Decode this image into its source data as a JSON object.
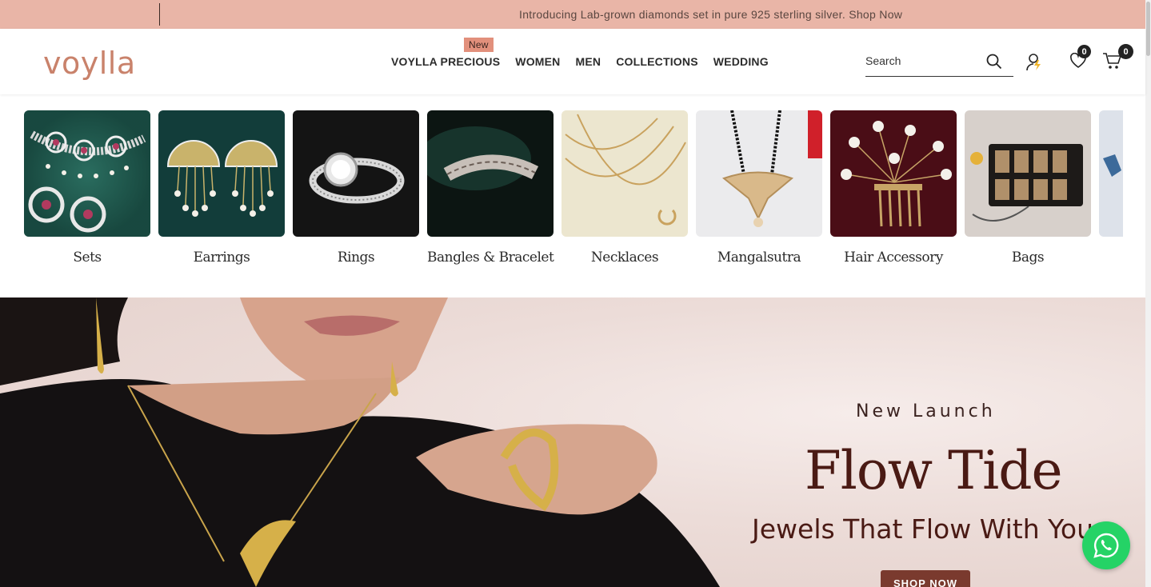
{
  "announcement": {
    "text": "Introducing Lab-grown diamonds set in pure 925 sterling silver. Shop Now"
  },
  "header": {
    "logo": "voylla",
    "nav": [
      {
        "label": "VOYLLA PRECIOUS",
        "badge": "New"
      },
      {
        "label": "WOMEN"
      },
      {
        "label": "MEN"
      },
      {
        "label": "COLLECTIONS"
      },
      {
        "label": "WEDDING"
      }
    ],
    "search_placeholder": "Search",
    "wishlist_count": "0",
    "cart_count": "0"
  },
  "categories": [
    {
      "label": "Sets"
    },
    {
      "label": "Earrings"
    },
    {
      "label": "Rings"
    },
    {
      "label": "Bangles & Bracelet"
    },
    {
      "label": "Necklaces"
    },
    {
      "label": "Mangalsutra"
    },
    {
      "label": "Hair Accessory"
    },
    {
      "label": "Bags"
    }
  ],
  "hero": {
    "kicker": "New Launch",
    "title": "Flow Tide",
    "tagline": "Jewels That Flow With You",
    "cta": "SHOP NOW"
  },
  "colors": {
    "announcement_bg": "#e9b5a7",
    "brand": "#c9826b",
    "hero_text": "#4a1a14",
    "whatsapp": "#25d366"
  }
}
